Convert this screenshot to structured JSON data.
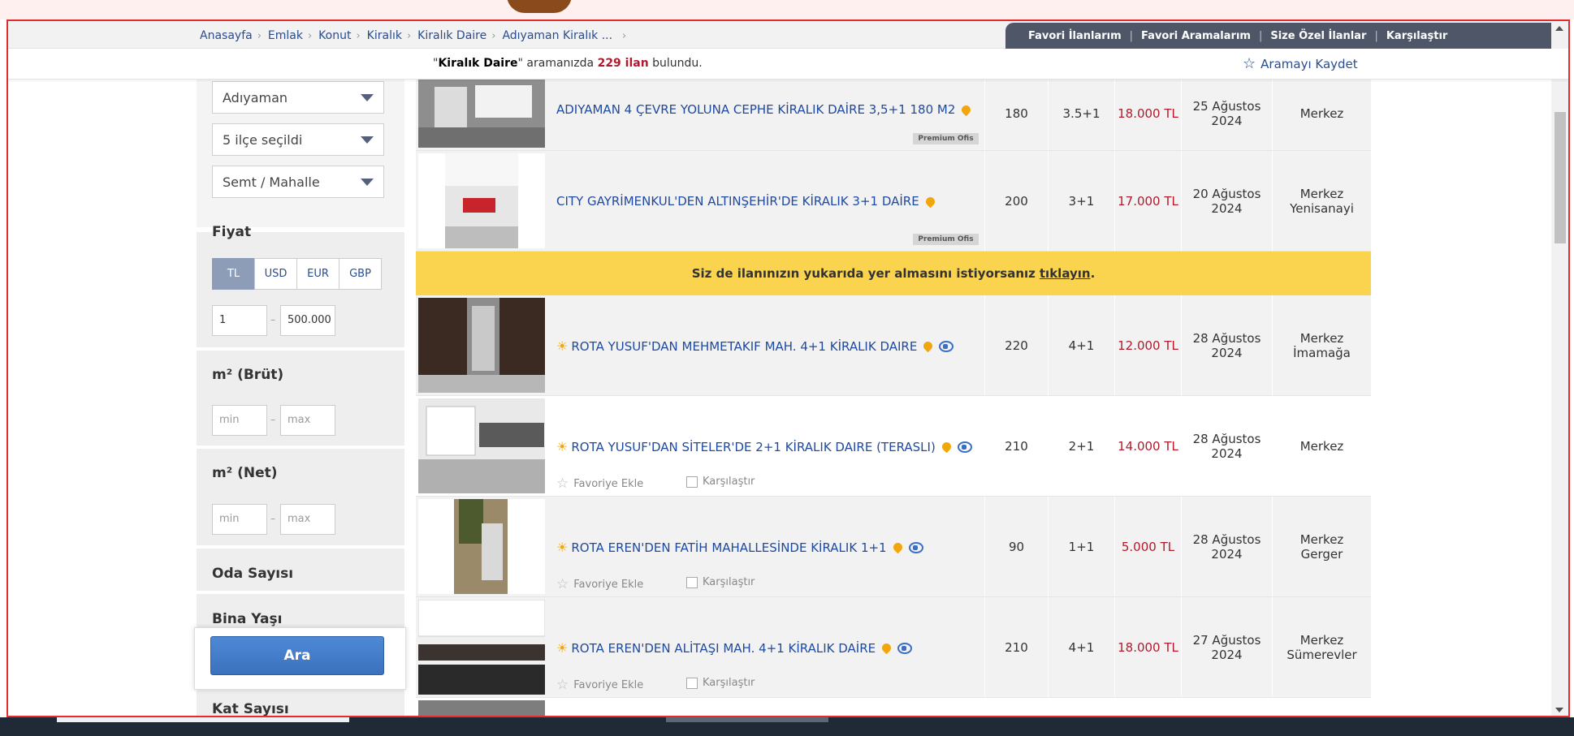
{
  "breadcrumb": [
    "Anasayfa",
    "Emlak",
    "Konut",
    "Kiralık",
    "Kiralık Daire",
    "Adıyaman Kiralık ..."
  ],
  "top_links": [
    "Favori İlanlarım",
    "Favori Aramalarım",
    "Size Özel İlanlar",
    "Karşılaştır"
  ],
  "result": {
    "prefix": "\"",
    "query": "Kiralık Daire",
    "middle": "\" aramanızda ",
    "count": "229 ilan",
    "suffix": " bulundu."
  },
  "save_search": "Aramayı Kaydet",
  "sidebar": {
    "city": "Adıyaman",
    "district": "5 ilçe seçildi",
    "neighborhood": "Semt / Mahalle",
    "price_title": "Fiyat",
    "currencies": [
      "TL",
      "USD",
      "EUR",
      "GBP"
    ],
    "active_currency": "TL",
    "price_min": "1",
    "price_max": "500.000",
    "m2_brut_title": "m² (Brüt)",
    "m2_net_title": "m² (Net)",
    "min_placeholder": "min",
    "max_placeholder": "max",
    "rooms_title": "Oda Sayısı",
    "age_title": "Bina Yaşı",
    "floors_title": "Kat Sayısı",
    "search_button": "Ara"
  },
  "listings": [
    {
      "title": "ADIYAMAN 4 ÇEVRE YOLUNA CEPHE KİRALIK DAİRE 3,5+1 180 M2",
      "m2": "180",
      "rooms": "3.5+1",
      "price": "18.000 TL",
      "date": "25 Ağustos 2024",
      "location": "Merkez",
      "premium": "Premium Ofis"
    },
    {
      "title": "CITY GAYRİMENKUL'DEN ALTINŞEHİR'DE KİRALIK 3+1 DAİRE",
      "m2": "200",
      "rooms": "3+1",
      "price": "17.000 TL",
      "date": "20 Ağustos 2024",
      "location": "Merkez Yenisanayi",
      "premium": "Premium Ofis"
    },
    {
      "title": "ROTA YUSUF'DAN MEHMETAKIF MAH. 4+1 KİRALIK DAIRE",
      "m2": "220",
      "rooms": "4+1",
      "price": "12.000 TL",
      "date": "28 Ağustos 2024",
      "location": "Merkez İmamağa"
    },
    {
      "title": "ROTA YUSUF'DAN SİTELER'DE 2+1 KİRALIK DAIRE (TERASLI)",
      "m2": "210",
      "rooms": "2+1",
      "price": "14.000 TL",
      "date": "28 Ağustos 2024",
      "location": "Merkez",
      "fav": "Favoriye Ekle",
      "compare": "Karşılaştır"
    },
    {
      "title": "ROTA EREN'DEN FATİH MAHALLESİNDE KİRALIK 1+1",
      "m2": "90",
      "rooms": "1+1",
      "price": "5.000 TL",
      "date": "28 Ağustos 2024",
      "location": "Merkez Gerger",
      "fav": "Favoriye Ekle",
      "compare": "Karşılaştır"
    },
    {
      "title": "ROTA EREN'DEN ALİTAŞI MAH. 4+1 KİRALIK DAİRE",
      "m2": "210",
      "rooms": "4+1",
      "price": "18.000 TL",
      "date": "27 Ağustos 2024",
      "location": "Merkez Sümerevler",
      "fav": "Favoriye Ekle",
      "compare": "Karşılaştır"
    }
  ],
  "promo": {
    "text": "Siz de ilanınızın yukarıda yer almasını istiyorsanız",
    "link": "tıklayın",
    "end": "."
  },
  "colors": {
    "accent": "#1f4aa0",
    "price": "#b3192d",
    "promo": "#fbd44f",
    "nav": "#4f5668",
    "frame": "#e52b2b"
  }
}
